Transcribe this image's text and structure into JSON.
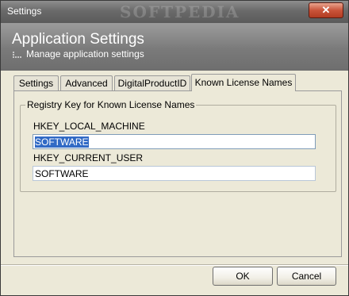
{
  "window": {
    "title": "Settings",
    "close_glyph": "✕",
    "watermark": "SOFTPEDIA"
  },
  "header": {
    "title": "Application Settings",
    "subtitle": "Manage application settings",
    "subtitle_icon": "dots-icon"
  },
  "tabs": [
    {
      "label": "Settings",
      "active": false
    },
    {
      "label": "Advanced",
      "active": false
    },
    {
      "label": "DigitalProductID",
      "active": false
    },
    {
      "label": "Known License Names",
      "active": true
    }
  ],
  "group": {
    "legend": "Registry Key for Known License Names",
    "local_machine": {
      "label": "HKEY_LOCAL_MACHINE",
      "value": "SOFTWARE"
    },
    "current_user": {
      "label": "HKEY_CURRENT_USER",
      "value": "SOFTWARE"
    }
  },
  "buttons": {
    "ok": "OK",
    "cancel": "Cancel"
  },
  "colors": {
    "selection": "#316ac5",
    "dialog_bg": "#ece9d8",
    "title_gray": "#6a6a6a"
  }
}
